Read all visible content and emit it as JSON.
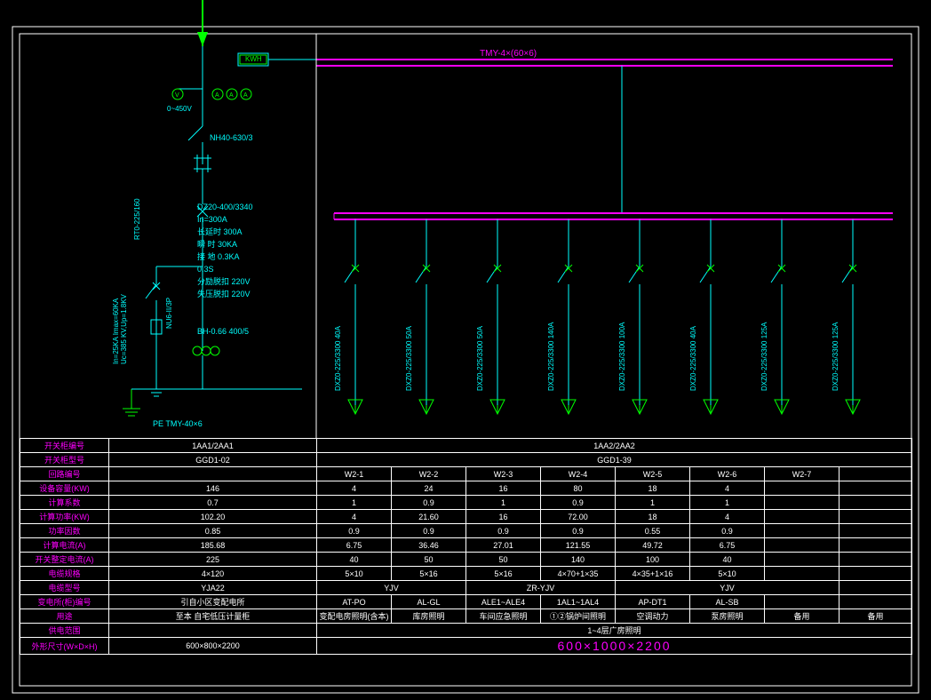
{
  "busbar_label": "TMY-4×(60×6)",
  "kwh": "KWH",
  "volt_range": "0~450V",
  "incoming": {
    "switch": "NH40-630/3",
    "fuse_left": "RT0-225/160",
    "spd_params": "In=25KA Imax=60KA\nUc=385 KV,Up=1.8KV",
    "spd": "NU6-II/3P",
    "breaker_block": [
      "DZ20-400/3340",
      "In=300A",
      "长延时  300A",
      "瞬  时  30KA",
      "接  地  0.3KA",
      "        0.3S",
      "分励脱扣 220V",
      "失压脱扣 220V"
    ],
    "ct": "BH-0.66 400/5",
    "pe": "PE  TMY-40×6"
  },
  "feeders": [
    {
      "bk": "DXZ0-225/3300 40A"
    },
    {
      "bk": "DXZ0-225/3300 50A"
    },
    {
      "bk": "DXZ0-225/3300 50A"
    },
    {
      "bk": "DXZ0-225/3300 140A"
    },
    {
      "bk": "DXZ0-225/3300 100A"
    },
    {
      "bk": "DXZ0-225/3300 40A"
    },
    {
      "bk": "DXZ0-225/3300 125A"
    },
    {
      "bk": "DXZ0-225/3300 125A"
    }
  ],
  "table": {
    "row_labels": [
      "开关柜编号",
      "开关柜型号",
      "回路编号",
      "设备容量(KW)",
      "计算系数",
      "计算功率(KW)",
      "功率因数",
      "计算电流(A)",
      "开关整定电流(A)",
      "电缆规格",
      "电缆型号",
      "变电所(柜)编号",
      "用途",
      "供电范围",
      "外形尺寸(W×D×H)"
    ],
    "incoming_col": [
      "1AA1/2AA1",
      "GGD1-02",
      "",
      "146",
      "0.7",
      "102.20",
      "0.85",
      "185.68",
      "225",
      "4×120",
      "YJA22",
      "引自小区变配电所",
      "至本 自宅低压计量柜",
      "",
      "600×800×2200"
    ],
    "panel_header": "1AA2/2AA2",
    "panel_model": "GGD1-39",
    "circuits": [
      "W2-1",
      "W2-2",
      "W2-3",
      "W2-4",
      "W2-5",
      "W2-6",
      "W2-7"
    ],
    "rows": [
      [
        "4",
        "24",
        "16",
        "80",
        "18",
        "4",
        ""
      ],
      [
        "1",
        "0.9",
        "1",
        "0.9",
        "1",
        "1",
        ""
      ],
      [
        "4",
        "21.60",
        "16",
        "72.00",
        "18",
        "4",
        ""
      ],
      [
        "0.9",
        "0.9",
        "0.9",
        "0.9",
        "0.55",
        "0.9",
        ""
      ],
      [
        "6.75",
        "36.46",
        "27.01",
        "121.55",
        "49.72",
        "6.75",
        ""
      ],
      [
        "40",
        "50",
        "50",
        "140",
        "100",
        "40",
        ""
      ],
      [
        "5×10",
        "5×16",
        "5×16",
        "4×70+1×35",
        "4×35+1×16",
        "5×10",
        ""
      ]
    ],
    "cable_type": [
      "YJV",
      "",
      "ZR-YJV",
      "",
      "YJV",
      "",
      ""
    ],
    "substation": [
      "AT-PO",
      "AL-GL",
      "ALE1~ALE4",
      "1AL1~1AL4",
      "AP-DT1",
      "AL-SB",
      ""
    ],
    "usage": [
      "变配电房照明(含本)",
      "库房照明",
      "车间应急照明",
      "①②锅炉间照明",
      "空调动力",
      "泵房照明",
      "备用",
      "备用"
    ],
    "scope": "1~4层广房照明",
    "dims": "600×1000×2200"
  }
}
